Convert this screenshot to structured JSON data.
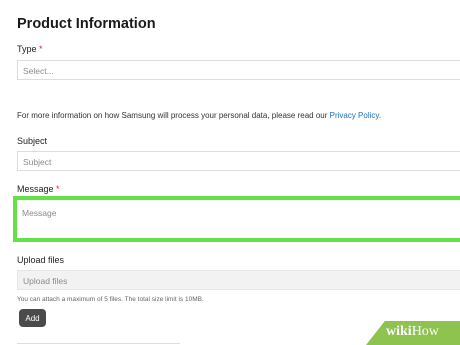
{
  "section": {
    "title": "Product Information"
  },
  "type_field": {
    "label": "Type",
    "required_mark": "*",
    "placeholder": "Select..."
  },
  "privacy": {
    "text": "For more information on how Samsung will process your personal data, please read our ",
    "link_label": "Privacy Policy",
    "suffix": "."
  },
  "subject_field": {
    "label": "Subject",
    "placeholder": "Subject"
  },
  "message_field": {
    "label": "Message",
    "required_mark": "*",
    "placeholder": "Message",
    "highlight_color": "#63e245"
  },
  "upload": {
    "label": "Upload files",
    "placeholder": "Upload files",
    "hint": "You can attach a maximum of 5 files. The total size limit is 10MB.",
    "add_label": "Add"
  },
  "watermark": {
    "text_bold": "wiki",
    "text_light": "How"
  }
}
